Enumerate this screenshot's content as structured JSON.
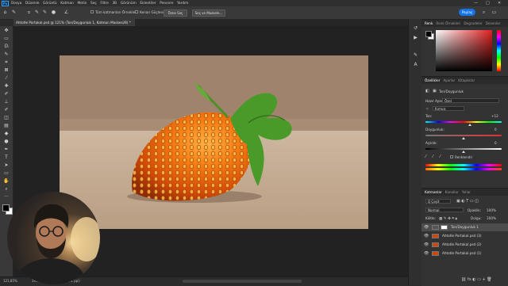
{
  "app": {
    "logo": "Ps"
  },
  "menu": [
    "Dosya",
    "Düzenle",
    "Görüntü",
    "Katman",
    "Metin",
    "Seç",
    "Filtre",
    "3B",
    "Görünüm",
    "Eklentiler",
    "Pencere",
    "Yardım"
  ],
  "window_controls": [
    "—",
    "□",
    "✕"
  ],
  "options_bar": {
    "sample_all_label": "Tüm katmanları Örnekle",
    "auto_enhance_label": "Kenarı Güçlendir",
    "select_subject_label": "Özne Seç",
    "select_and_mask_label": "Seç ve Maskele...",
    "share_label": "Paylaş"
  },
  "document_tab": "Ahtotle Portakal.psd @ 121% (Ton/Doygunluk 1, Katman Maskesi/8) *",
  "status": {
    "zoom": "121,85%",
    "dimensions": "1960 piks x 1102 piks (72 ppi)"
  },
  "color_panel": {
    "tabs": [
      "Renk",
      "Renk Örnekleri",
      "Degradeler",
      "Desenler"
    ]
  },
  "properties_panel": {
    "tabs": [
      "Özellikler",
      "Ayarlar",
      "Kitaplıklar"
    ],
    "title": "Ton/Doygunluk",
    "preset_label": "Hazır Ayar:",
    "preset_value": "Özel",
    "channel_value": "Kırmızı",
    "hue_label": "Ton:",
    "hue_value": "+12",
    "saturation_label": "Doygunluk:",
    "saturation_value": "0",
    "lightness_label": "Açıklık:",
    "lightness_value": "0",
    "colorize_label": "Renklendir"
  },
  "layers_panel": {
    "tabs": [
      "Katmanlar",
      "Kanallar",
      "Yollar"
    ],
    "filter_label": "Q Çeşit",
    "blend_mode": "Normal",
    "opacity_label": "Opaklık:",
    "opacity_value": "100%",
    "lock_label": "Kilitle:",
    "fill_label": "Dolgu:",
    "fill_value": "100%",
    "layers": [
      {
        "name": "Ton/Doygunluk 1",
        "selected": true
      },
      {
        "name": "Ahtotle Portakal.psd (3)",
        "selected": false
      },
      {
        "name": "Ahtotle Portakal.psd (2)",
        "selected": false
      },
      {
        "name": "Ahtotle Portakal.psd (1)",
        "selected": false
      }
    ]
  },
  "colors": {
    "accent": "#1473e6",
    "fg": "#000000",
    "bg": "#ffffff"
  }
}
